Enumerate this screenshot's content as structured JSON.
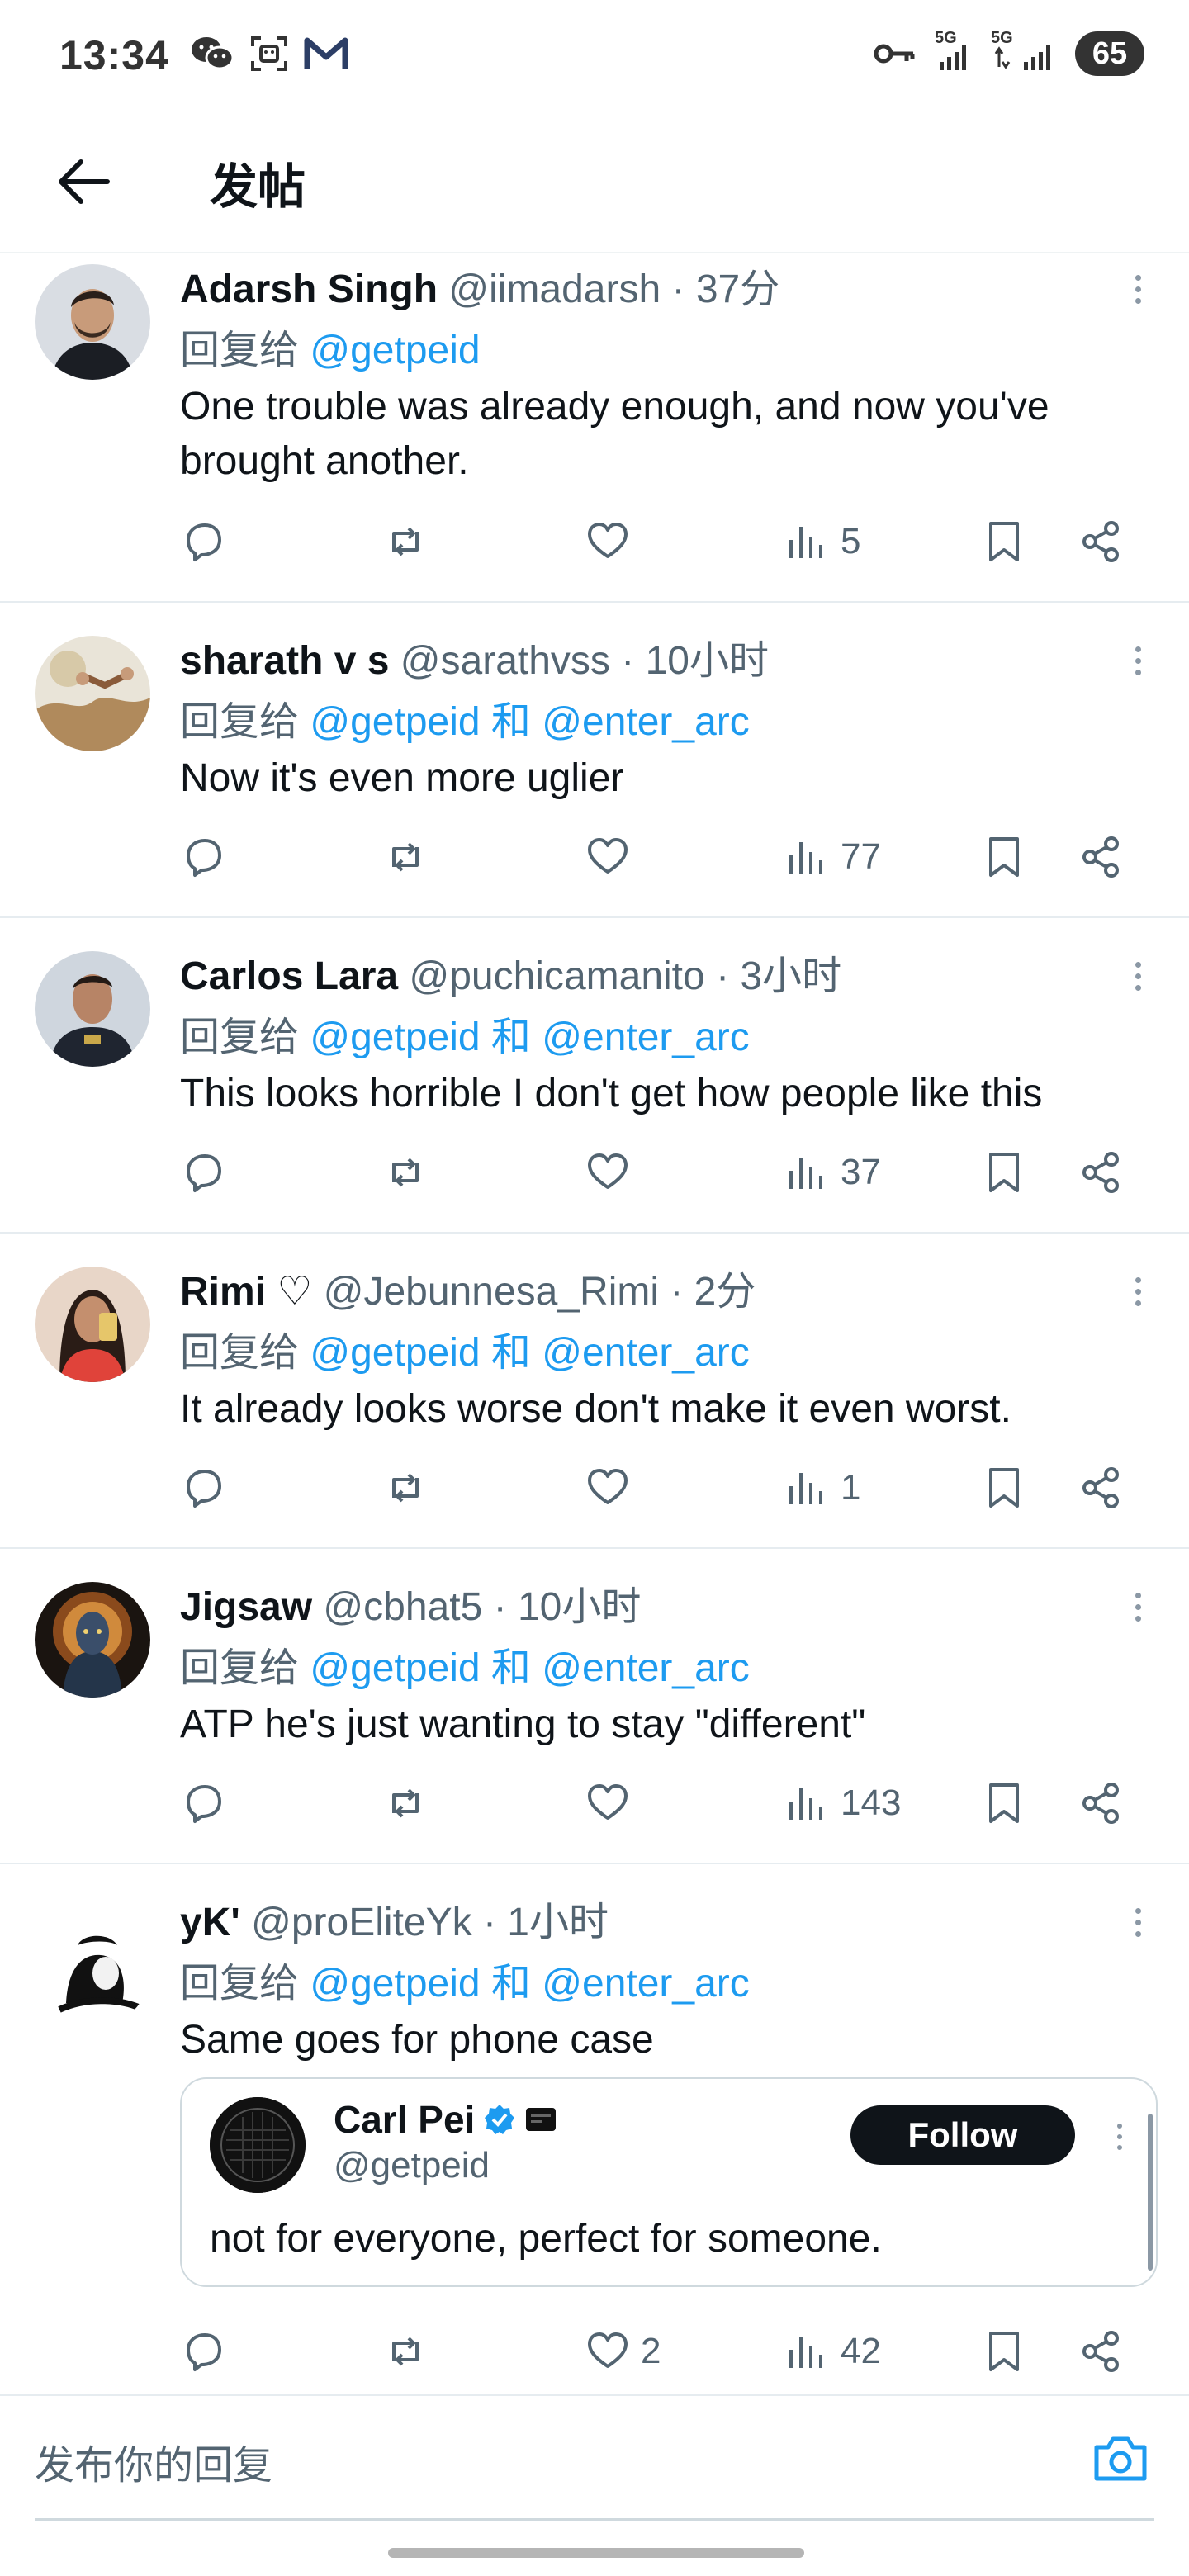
{
  "status_bar": {
    "time": "13:34",
    "left_icons": [
      "wechat-icon",
      "scan-icon",
      "gmail-icon"
    ],
    "right_icons": [
      "key-icon",
      "signal-5g-icon",
      "signal-5g-icon"
    ],
    "net1": "5G",
    "net2": "5G",
    "battery": "65"
  },
  "header": {
    "title": "发帖",
    "back_icon": "arrow-left-icon"
  },
  "tweets": [
    {
      "name": "Adarsh Singh",
      "handle": "@iimadarsh",
      "dot": "·",
      "time": "37分",
      "reply_prefix": "回复给",
      "mention1": "@getpeid",
      "and_word": "",
      "mention2": "",
      "text": "One trouble was already enough, and now you've brought another.",
      "views": "5",
      "likes": ""
    },
    {
      "name": "sharath v s",
      "handle": "@sarathvss",
      "dot": "·",
      "time": "10小时",
      "reply_prefix": "回复给",
      "mention1": "@getpeid",
      "and_word": "和",
      "mention2": "@enter_arc",
      "text": "Now it's even more uglier",
      "views": "77",
      "likes": ""
    },
    {
      "name": "Carlos Lara",
      "handle": "@puchicamanito",
      "dot": "·",
      "time": "3小时",
      "reply_prefix": "回复给",
      "mention1": "@getpeid",
      "and_word": "和",
      "mention2": "@enter_arc",
      "text": "This looks horrible I don't get how people like this",
      "views": "37",
      "likes": ""
    },
    {
      "name": "Rimi ♡",
      "handle": "@Jebunnesa_Rimi",
      "dot": "·",
      "time": "2分",
      "reply_prefix": "回复给",
      "mention1": "@getpeid",
      "and_word": "和",
      "mention2": "@enter_arc",
      "text": "It already looks worse don't make it even worst.",
      "views": "1",
      "likes": ""
    },
    {
      "name": "Jigsaw",
      "handle": "@cbhat5",
      "dot": "·",
      "time": "10小时",
      "reply_prefix": "回复给",
      "mention1": "@getpeid",
      "and_word": "和",
      "mention2": "@enter_arc",
      "text": "ATP he's just wanting to stay \"different\"",
      "views": "143",
      "likes": ""
    },
    {
      "name": "yK'",
      "handle": "@proEliteYk",
      "dot": "·",
      "time": "1小时",
      "reply_prefix": "回复给",
      "mention1": "@getpeid",
      "and_word": "和",
      "mention2": "@enter_arc",
      "text": "Same goes for phone case",
      "views": "42",
      "likes": "2"
    }
  ],
  "quote": {
    "name": "Carl Pei",
    "handle": "@getpeid",
    "follow_label": "Follow",
    "text": "not for everyone, perfect for someone."
  },
  "compose": {
    "placeholder": "发布你的回复",
    "camera_icon": "camera-icon"
  },
  "colors": {
    "link": "#1d9bf0",
    "muted": "#536471",
    "text": "#0f1419",
    "divider": "#e6ecf0"
  }
}
